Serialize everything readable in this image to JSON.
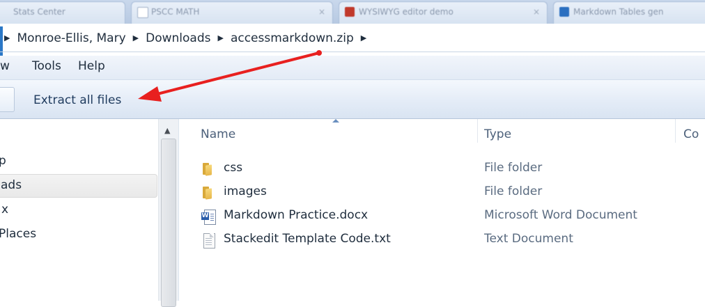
{
  "browser_tabs": [
    {
      "label": "Stats Center",
      "icon": "blank-icon"
    },
    {
      "label": "PSCC MATH",
      "icon": "page-icon"
    },
    {
      "label": "WYSIWYG editor demo",
      "icon": "red-app-icon"
    },
    {
      "label": "Markdown Tables gen",
      "icon": "blue-app-icon"
    }
  ],
  "breadcrumb": {
    "items": [
      "Monroe-Ellis, Mary",
      "Downloads",
      "accessmarkdown.zip"
    ]
  },
  "menu": {
    "items": [
      "w",
      "Tools",
      "Help"
    ]
  },
  "toolbar": {
    "extract_label": "Extract all files"
  },
  "nav_pane": {
    "items": [
      "p",
      "ads",
      "x",
      "Places"
    ],
    "selected_index": 1
  },
  "file_list": {
    "columns": [
      "Name",
      "Type",
      "Co"
    ],
    "rows": [
      {
        "name": "css",
        "type": "File folder",
        "icon": "folder-icon"
      },
      {
        "name": "images",
        "type": "File folder",
        "icon": "folder-icon"
      },
      {
        "name": "Markdown Practice.docx",
        "type": "Microsoft Word Document",
        "icon": "word-document-icon"
      },
      {
        "name": "Stackedit Template Code.txt",
        "type": "Text Document",
        "icon": "text-document-icon"
      }
    ]
  },
  "annotation": {
    "arrow_color": "#e8201f"
  }
}
